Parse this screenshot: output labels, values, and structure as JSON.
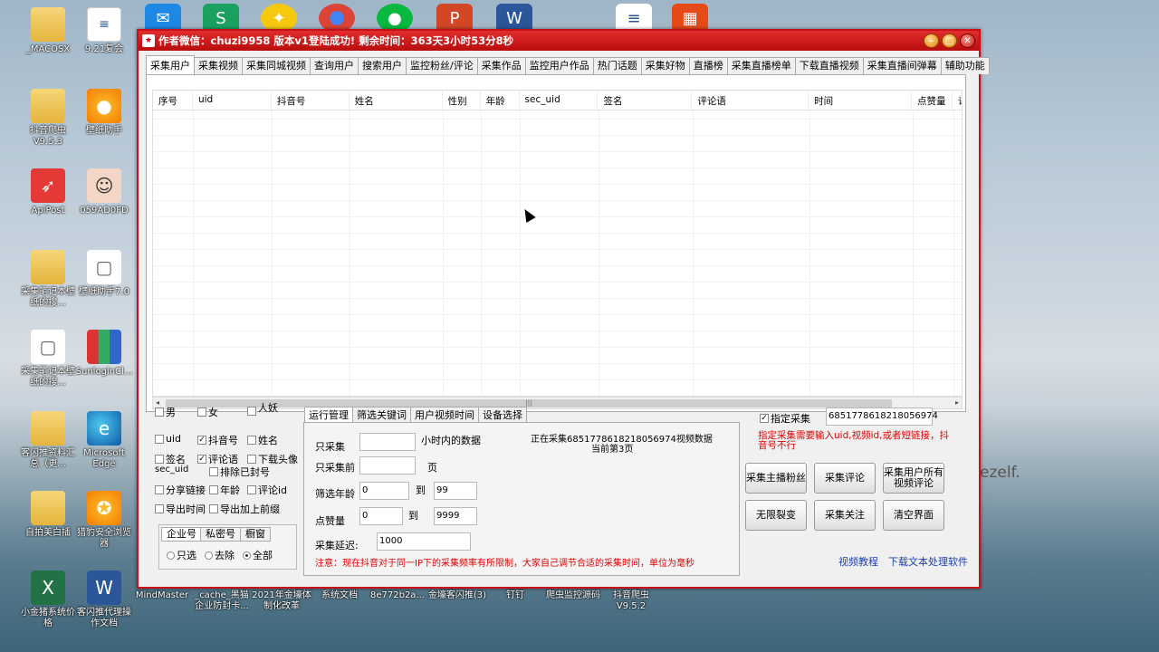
{
  "desktop": {
    "icons": [
      {
        "label": "_MACOSX",
        "icon": "folder-icon"
      },
      {
        "label": "9.21复会",
        "icon": "document-icon"
      },
      {
        "label": "抖音爬虫V9.5.3",
        "icon": "folder-zip-icon"
      },
      {
        "label": "壁纸助手",
        "icon": "paint-palette-icon"
      },
      {
        "label": "ApiPost",
        "icon": "apipost-icon"
      },
      {
        "label": "059AD0FD",
        "icon": "avatar-icon"
      },
      {
        "label": "采集笔记本壁纸的搜...",
        "icon": "folder-icon"
      },
      {
        "label": "壁纸助手7.0",
        "icon": "document-icon"
      },
      {
        "label": "采集笔记本壁纸的搜...",
        "icon": "document-icon"
      },
      {
        "label": "SunloginCl...",
        "icon": "winrar-icon"
      },
      {
        "label": "客闪推资料汇总（更...",
        "icon": "folder-icon"
      },
      {
        "label": "Microsoft Edge",
        "icon": "edge-icon"
      },
      {
        "label": "自拍美白插",
        "icon": "folder-icon"
      },
      {
        "label": "猎豹安全浏览器",
        "icon": "browser-icon"
      },
      {
        "label": "小金猪系统价格",
        "icon": "excel-icon"
      },
      {
        "label": "客闪推代理操作文档",
        "icon": "word-icon"
      },
      {
        "label": "MindMaster",
        "icon": "mindmaster-icon"
      },
      {
        "label": "_cache_黑猫企业防封卡...",
        "icon": "folder-icon"
      },
      {
        "label": "2021年金壕体制化改革",
        "icon": "document-icon"
      },
      {
        "label": "系统文档",
        "icon": "winrar-icon"
      },
      {
        "label": "8e772b2a...",
        "icon": "winrar-icon"
      },
      {
        "label": "金壕客闪推(3)",
        "icon": "document-icon"
      },
      {
        "label": "钉钉",
        "icon": "dingtalk-icon"
      },
      {
        "label": "爬虫监控源码",
        "icon": "winrar-icon"
      },
      {
        "label": "抖音爬虫V9.5.2",
        "icon": "folder-zip-icon"
      }
    ],
    "watermark": "ezelf."
  },
  "window": {
    "title": "作者微信：chuzi9958 版本v1登陆成功! 剩余时间：363天3小时53分8秒",
    "title_color": "#c8101a",
    "tabs": [
      "采集用户",
      "采集视频",
      "采集同城视频",
      "查询用户",
      "搜索用户",
      "监控粉丝/评论",
      "采集作品",
      "监控用户作品",
      "热门话题",
      "采集好物",
      "直播榜",
      "采集直播榜单",
      "下载直播视频",
      "采集直播间弹幕",
      "辅助功能"
    ],
    "active_tab": 0,
    "grid": {
      "columns": [
        "序号",
        "uid",
        "抖音号",
        "姓名",
        "性别",
        "年龄",
        "sec_uid",
        "签名",
        "评论语",
        "时间",
        "点赞量",
        "评"
      ]
    },
    "filters": {
      "gender": [
        {
          "label": "男",
          "checked": false
        },
        {
          "label": "女",
          "checked": false
        },
        {
          "label": "人妖",
          "checked": false
        }
      ],
      "fields": [
        {
          "label": "uid",
          "checked": false
        },
        {
          "label": "抖音号",
          "checked": true
        },
        {
          "label": "姓名",
          "checked": false
        },
        {
          "label": "签名",
          "checked": false
        },
        {
          "label": "评论语",
          "checked": true
        },
        {
          "label": "下载头像",
          "checked": false
        },
        {
          "label": "sec_uid",
          "checked": false
        },
        {
          "label": "排除已封号",
          "checked": false
        },
        {
          "label": "分享链接",
          "checked": false
        },
        {
          "label": "年龄",
          "checked": false
        },
        {
          "label": "评论id",
          "checked": false
        },
        {
          "label": "导出时间",
          "checked": false
        },
        {
          "label": "导出加上前缀",
          "checked": false
        }
      ],
      "account_tabs": [
        "企业号",
        "私密号",
        "橱窗"
      ],
      "account_radios": [
        {
          "label": "只选",
          "checked": false
        },
        {
          "label": "去除",
          "checked": false
        },
        {
          "label": "全部",
          "checked": true
        }
      ]
    },
    "run": {
      "tabs": [
        "运行管理",
        "筛选关键词",
        "用户视频时间",
        "设备选择"
      ],
      "only_collect_label": "只采集",
      "hours_label": "小时内的数据",
      "only_pages_label": "只采集前",
      "page_unit": "页",
      "age_label": "筛选年龄",
      "age_from": "0",
      "age_to": "99",
      "to_label": "到",
      "likes_label": "点赞量",
      "likes_from": "0",
      "likes_to": "9999",
      "delay_label": "采集延迟:",
      "delay_value": "1000",
      "status_line1": "正在采集6851778618218056974视频数据",
      "status_line2": "当前第3页",
      "note": "注意：现在抖音对于同一IP下的采集频率有所限制，大家自己调节合适的采集时间，单位为毫秒"
    },
    "right": {
      "specify_label": "指定采集",
      "specify_checked": true,
      "specify_value": "6851778618218056974",
      "hint": "指定采集需要输入uid,视频id,或者短链接，抖音号不行",
      "buttons": [
        "采集主播粉丝",
        "采集评论",
        "采集用户所有视频评论",
        "无限裂变",
        "采集关注",
        "清空界面"
      ],
      "link_video": "视频教程",
      "link_download": "下载文本处理软件"
    }
  }
}
